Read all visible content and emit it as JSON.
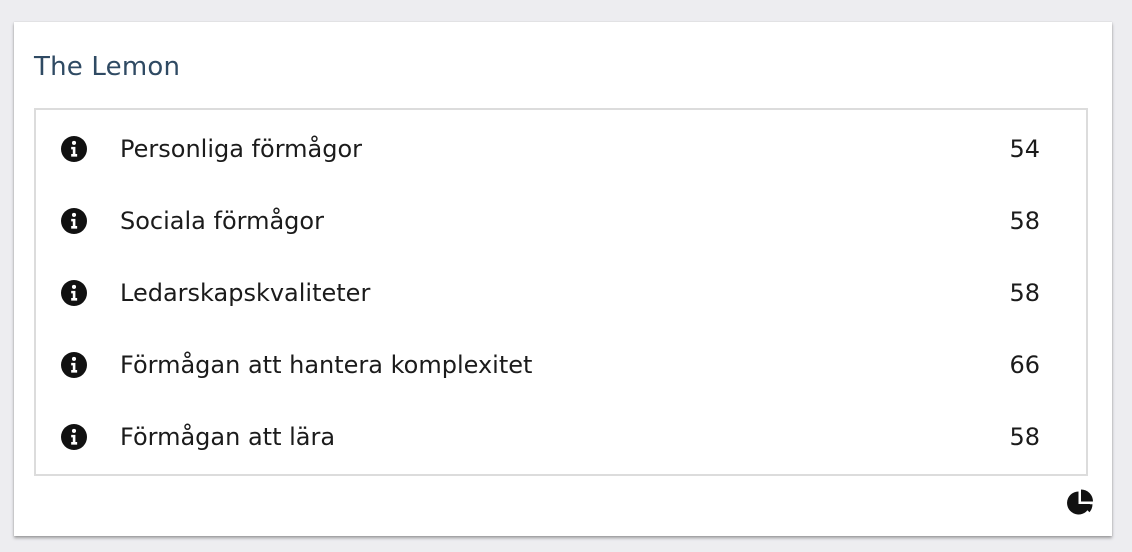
{
  "card": {
    "title": "The Lemon"
  },
  "rows": [
    {
      "label": "Personliga förmågor",
      "value": "54",
      "icon": "info-icon"
    },
    {
      "label": "Sociala förmågor",
      "value": "58",
      "icon": "info-icon"
    },
    {
      "label": "Ledarskapskvaliteter",
      "value": "58",
      "icon": "info-icon"
    },
    {
      "label": "Förmågan att hantera komplexitet",
      "value": "66",
      "icon": "info-icon"
    },
    {
      "label": "Förmågan att lära",
      "value": "58",
      "icon": "info-icon"
    }
  ],
  "footer": {
    "icon": "pie-chart-icon"
  },
  "colors": {
    "background": "#ededf0",
    "card": "#ffffff",
    "title": "#2f4a63",
    "text": "#1b1b1b",
    "border": "#dcdcdc"
  }
}
